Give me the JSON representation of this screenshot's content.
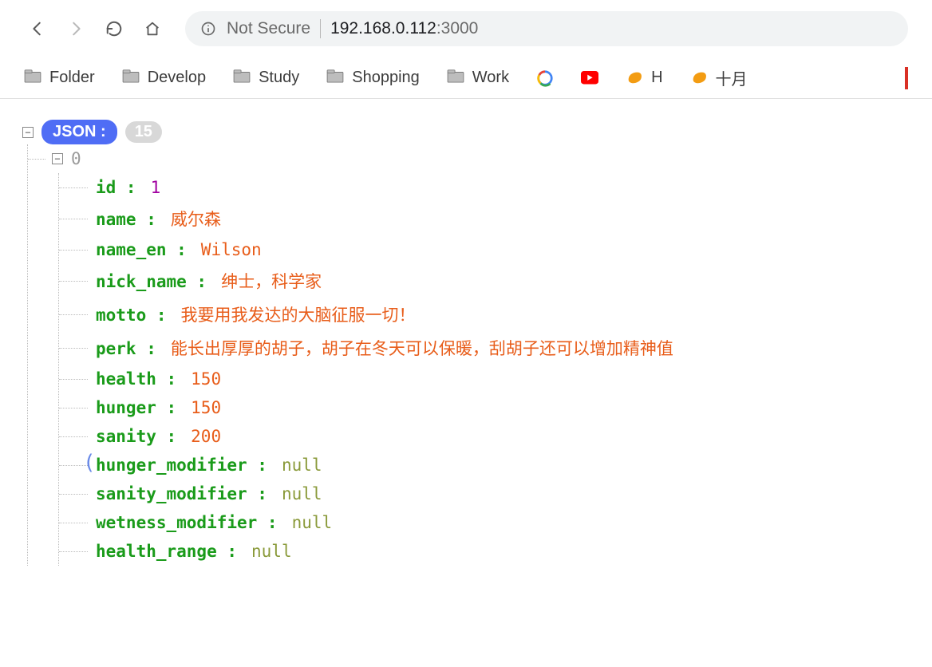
{
  "browser": {
    "not_secure_label": "Not Secure",
    "url_host": "192.168.0.112",
    "url_port": ":3000"
  },
  "bookmarks": {
    "folder": "Folder",
    "develop": "Develop",
    "study": "Study",
    "shopping": "Shopping",
    "work": "Work",
    "h": "H",
    "october": "十月"
  },
  "json_viewer": {
    "root_label": "JSON :",
    "count": "15",
    "index_label": "0",
    "properties": [
      {
        "key": "id",
        "value": "1",
        "type": "number"
      },
      {
        "key": "name",
        "value": "威尔森",
        "type": "string"
      },
      {
        "key": "name_en",
        "value": "Wilson",
        "type": "string"
      },
      {
        "key": "nick_name",
        "value": "绅士，科学家",
        "type": "string"
      },
      {
        "key": "motto",
        "value": "我要用我发达的大脑征服一切！",
        "type": "string"
      },
      {
        "key": "perk",
        "value": "能长出厚厚的胡子，胡子在冬天可以保暖，刮胡子还可以增加精神值",
        "type": "string"
      },
      {
        "key": "health",
        "value": "150",
        "type": "num_orange"
      },
      {
        "key": "hunger",
        "value": "150",
        "type": "num_orange"
      },
      {
        "key": "sanity",
        "value": "200",
        "type": "num_orange"
      },
      {
        "key": "hunger_modifier",
        "value": "null",
        "type": "null"
      },
      {
        "key": "sanity_modifier",
        "value": "null",
        "type": "null"
      },
      {
        "key": "wetness_modifier",
        "value": "null",
        "type": "null"
      },
      {
        "key": "health_range",
        "value": "null",
        "type": "null"
      }
    ]
  }
}
